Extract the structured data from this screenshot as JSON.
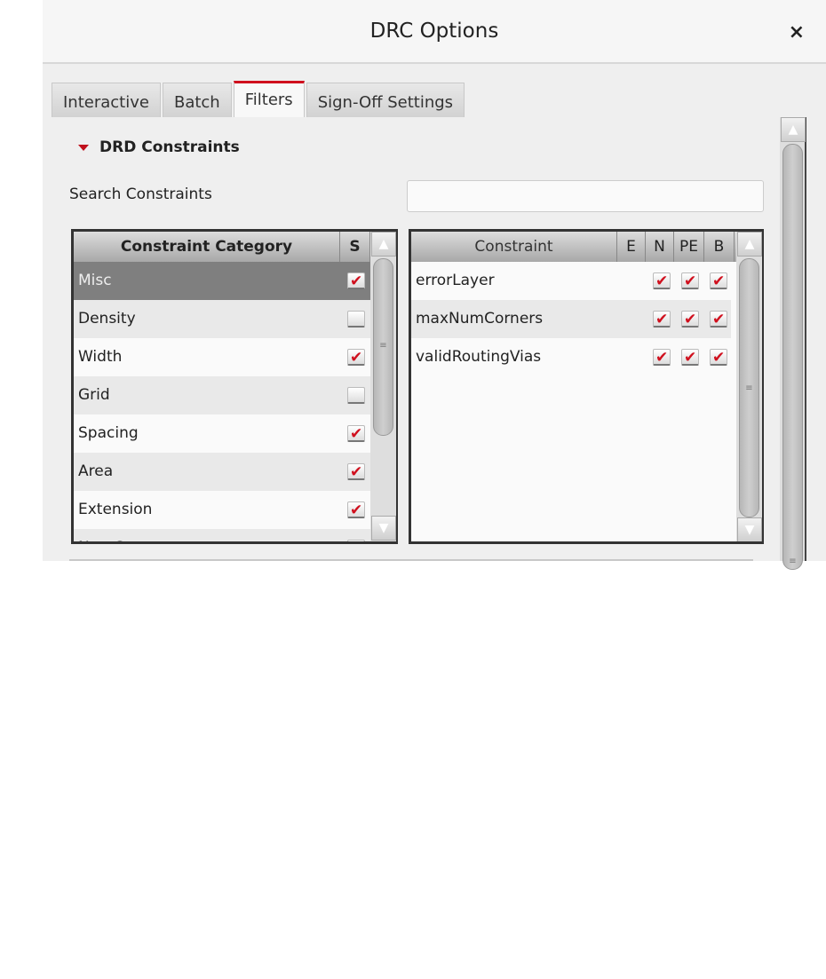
{
  "window": {
    "title": "DRC Options",
    "close_icon": "×"
  },
  "tabs": [
    {
      "label": "Interactive"
    },
    {
      "label": "Batch"
    },
    {
      "label": "Filters",
      "active": true
    },
    {
      "label": "Sign-Off Settings"
    }
  ],
  "section": {
    "title": "DRD Constraints"
  },
  "search": {
    "label": "Search Constraints",
    "value": ""
  },
  "categories": {
    "headers": {
      "name": "Constraint Category",
      "s": "S"
    },
    "rows": [
      {
        "name": "Misc",
        "s": true,
        "selected": true
      },
      {
        "name": "Density",
        "s": false
      },
      {
        "name": "Width",
        "s": true
      },
      {
        "name": "Grid",
        "s": false
      },
      {
        "name": "Spacing",
        "s": true
      },
      {
        "name": "Area",
        "s": true
      },
      {
        "name": "Extension",
        "s": true
      },
      {
        "name": "NumCuts",
        "s": true
      }
    ]
  },
  "constraints": {
    "headers": {
      "name": "Constraint",
      "e": "E",
      "n": "N",
      "pe": "PE",
      "b": "B"
    },
    "rows": [
      {
        "name": "errorLayer",
        "n": true,
        "pe": true,
        "b": true
      },
      {
        "name": "maxNumCorners",
        "n": true,
        "pe": true,
        "b": true
      },
      {
        "name": "validRoutingVias",
        "n": true,
        "pe": true,
        "b": true
      }
    ]
  },
  "colors": {
    "accent": "#d0101e",
    "selected_row": "#7f7f7f"
  }
}
